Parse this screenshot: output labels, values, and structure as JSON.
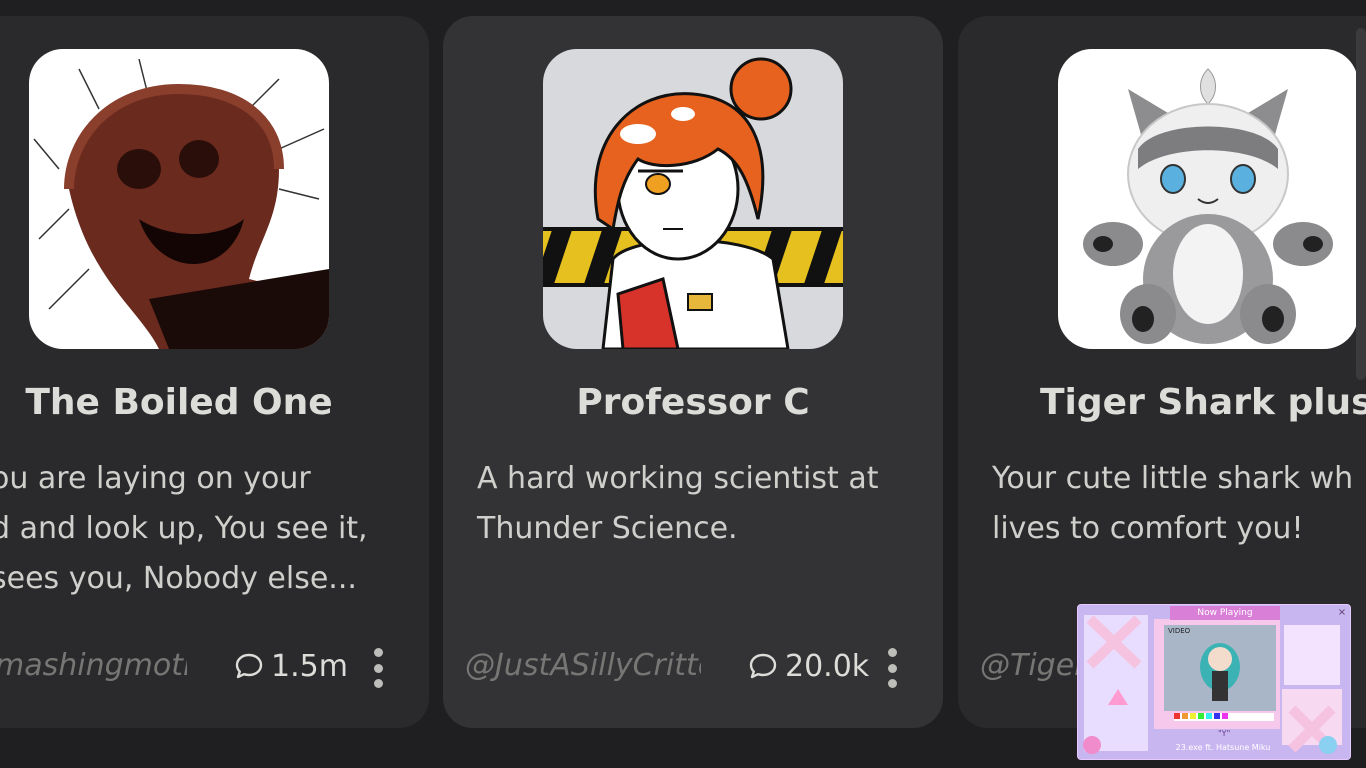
{
  "cards": [
    {
      "name": "The Boiled One",
      "description_lines": [
        "ou are laying on your",
        "d and look up, You see it,",
        "sees you, Nobody else..."
      ],
      "creator": "mashingmoth",
      "chat_count": "1.5m",
      "chat_icon": "chat-bubble-icon",
      "more_icon": "vertical-ellipsis-icon"
    },
    {
      "name": "Professor C",
      "description_lines": [
        "A hard working scientist at",
        "Thunder Science."
      ],
      "creator": "@JustASillyCritte",
      "chat_count": "20.0k",
      "chat_icon": "chat-bubble-icon",
      "more_icon": "vertical-ellipsis-icon"
    },
    {
      "name": "Tiger Shark plus",
      "description_lines": [
        "Your cute little shark wh",
        "lives to comfort you!"
      ],
      "creator": "@Tiger"
    }
  ],
  "mini_player": {
    "title": "Now Playing",
    "video_label": "VIDEO",
    "sub_label": "\"Y\"",
    "caption": "23.exe ft. Hatsune Miku",
    "close_icon": "close-icon"
  },
  "colors": {
    "background": "#1f1f21",
    "card": "#2a2a2c",
    "card_hover": "#333335",
    "text": "#dcdcd8",
    "muted": "#767675"
  }
}
